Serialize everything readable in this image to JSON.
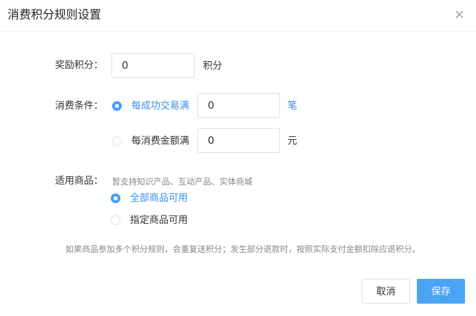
{
  "dialog": {
    "title": "消费积分规则设置",
    "close_icon": "close-icon"
  },
  "reward": {
    "label": "奖励积分：",
    "value": "0",
    "unit": "积分"
  },
  "condition": {
    "label": "消费条件：",
    "options": [
      {
        "label": "每成功交易满",
        "value": "0",
        "unit": "笔",
        "selected": true
      },
      {
        "label": "每消费金额满",
        "value": "0",
        "unit": "元",
        "selected": false
      }
    ]
  },
  "products": {
    "label": "适用商品：",
    "hint": "暂支持知识产品、互动产品、实体商城",
    "options": [
      {
        "label": "全部商品可用",
        "selected": true
      },
      {
        "label": "指定商品可用",
        "selected": false
      }
    ]
  },
  "note": "如果商品参加多个积分规则，会重复送积分；发生部分退款时，按照实际支付金额扣除应退积分。",
  "buttons": {
    "cancel": "取消",
    "save": "保存"
  },
  "colors": {
    "accent": "#409eff",
    "primary_button": "#4ba3f5",
    "active_text": "#3a8ee6"
  }
}
